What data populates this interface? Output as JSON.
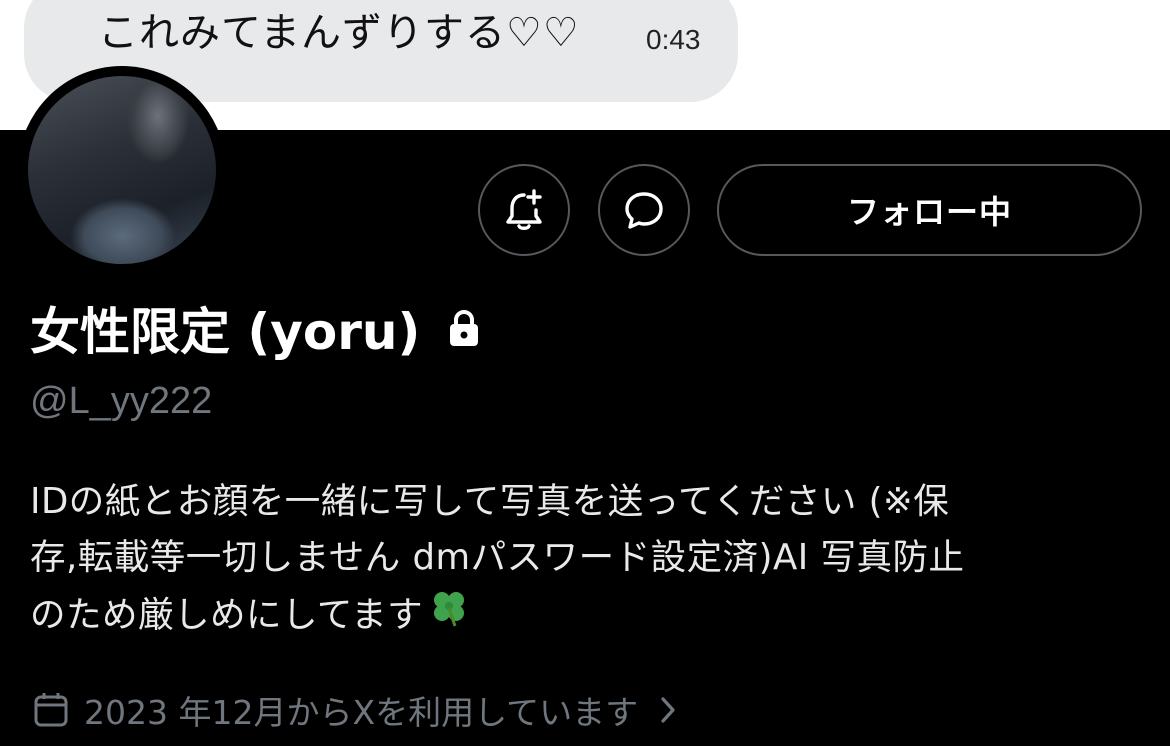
{
  "chat": {
    "message": "これみてまんずりする♡♡",
    "time": "0:43"
  },
  "profile": {
    "display_name": "女性限定 (yoru)",
    "handle": "@L_yy222",
    "follow_button": "フォロー中",
    "bio_line1": "IDの紙とお顔を一緒に写して写真を送ってください (※保",
    "bio_line2": "存,転載等一切しません dmパスワード設定済)AI 写真防止",
    "bio_line3": "のため厳しめにしてます",
    "joined": "2023 年12月からXを利用しています",
    "icons": {
      "notify": "bell-plus-icon",
      "message": "message-bubble-icon",
      "lock": "lock-icon",
      "calendar": "calendar-icon",
      "chevron": "chevron-right-icon",
      "emoji": "four-leaf-clover"
    }
  }
}
